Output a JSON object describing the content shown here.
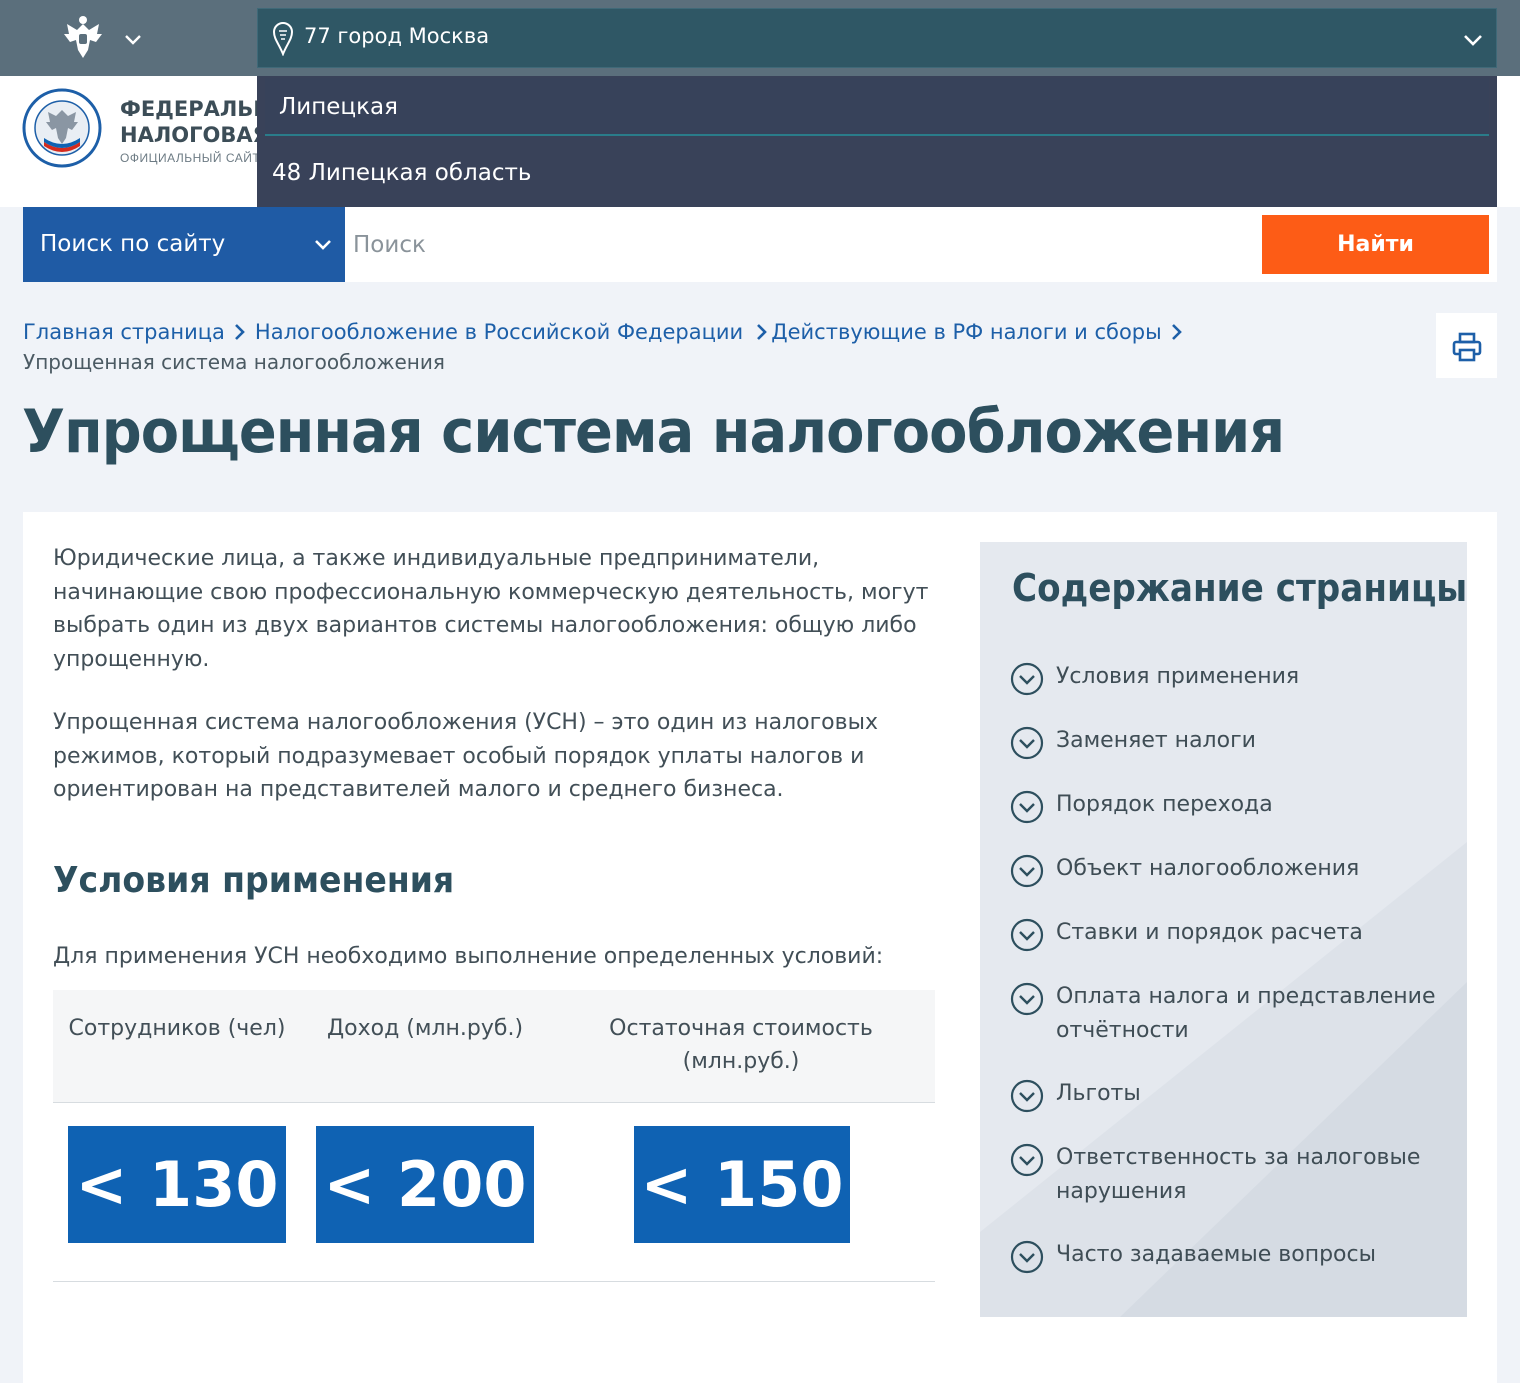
{
  "topbar": {
    "region_value": "77 город Москва"
  },
  "dropdown": {
    "search_text": "Липецкая",
    "option": "48 Липецкая область"
  },
  "logo": {
    "line1": "ФЕДЕРАЛЬНАЯ",
    "line2": "НАЛОГОВАЯ С",
    "line3": "ОФИЦИАЛЬНЫЙ САЙТ"
  },
  "search": {
    "scope_label": "Поиск по сайту",
    "placeholder": "Поиск",
    "button_label": "Найти"
  },
  "breadcrumbs": {
    "items": [
      "Главная страница",
      "Налогообложение в Российской Федерации",
      "Действующие в РФ налоги и сборы"
    ],
    "current": "Упрощенная система налогообложения"
  },
  "page": {
    "title": "Упрощенная система налогообложения",
    "paragraph1": "Юридические лица, а также индивидуальные предприниматели, начинающие свою профессиональную коммерческую деятельность, могут выбрать один из двух вариантов системы налогообложения: общую либо упрощенную.",
    "paragraph2": "Упрощенная система налогообложения (УСН) – это один из налоговых режимов, который подразумевает особый порядок уплаты налогов и ориентирован на представителей малого и среднего бизнеса.",
    "section_heading": "Условия применения",
    "paragraph3": "Для применения УСН необходимо выполнение определенных условий:"
  },
  "conditions": {
    "columns": [
      "Сотрудников (чел)",
      "Доход (млн.руб.)",
      "Остаточная стоимость (млн.руб.)"
    ],
    "values": [
      "< 130",
      "< 200",
      "< 150"
    ]
  },
  "toc": {
    "title": "Содержание страницы",
    "items": [
      "Условия применения",
      "Заменяет налоги",
      "Порядок перехода",
      "Объект налогообложения",
      "Ставки и порядок расчета",
      "Оплата налога и представление отчётности",
      "Льготы",
      "Ответственность за налоговые нарушения",
      "Часто задаваемые вопросы"
    ]
  },
  "colors": {
    "accent_blue": "#0f62b3",
    "link_blue": "#1d5fa8",
    "button_orange": "#fd5c16",
    "dropdown_bg": "#394259",
    "topbar_bg": "#5b6f7c"
  },
  "icons": [
    "emblem-icon",
    "chevron-down-icon",
    "location-pin-icon",
    "fns-logo-icon",
    "chevron-right-icon",
    "printer-icon",
    "circle-chevron-down-icon"
  ]
}
